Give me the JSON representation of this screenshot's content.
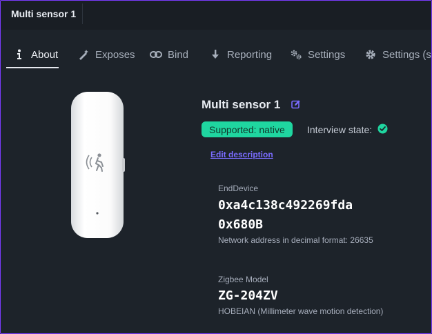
{
  "window": {
    "title": "Multi sensor 1"
  },
  "tabs": [
    {
      "label": "About",
      "icon": "info-icon",
      "active": true
    },
    {
      "label": "Exposes",
      "icon": "magic-wand-icon"
    },
    {
      "label": "Bind",
      "icon": "link-icon"
    },
    {
      "label": "Reporting",
      "icon": "arrow-down-icon"
    },
    {
      "label": "Settings",
      "icon": "cogs-icon"
    },
    {
      "label": "Settings (sp",
      "icon": "cog-icon"
    }
  ],
  "device": {
    "name": "Multi sensor 1",
    "support_status": "Supported: native",
    "interview_label": "Interview state:",
    "edit_description": "Edit description",
    "type": "EndDevice",
    "ieee_address": "0xa4c138c492269fda",
    "network_address": "0x680B",
    "network_address_note": "Network address in decimal format: 26635",
    "model_label": "Zigbee Model",
    "model": "ZG-204ZV",
    "vendor_description": "HOBEIAN (Millimeter wave motion detection)"
  },
  "colors": {
    "background": "#1d232a",
    "titlebar": "#191e24",
    "accent_purple": "#7a6cff",
    "success_green": "#1fd6a0",
    "window_border": "#7b3cff"
  }
}
